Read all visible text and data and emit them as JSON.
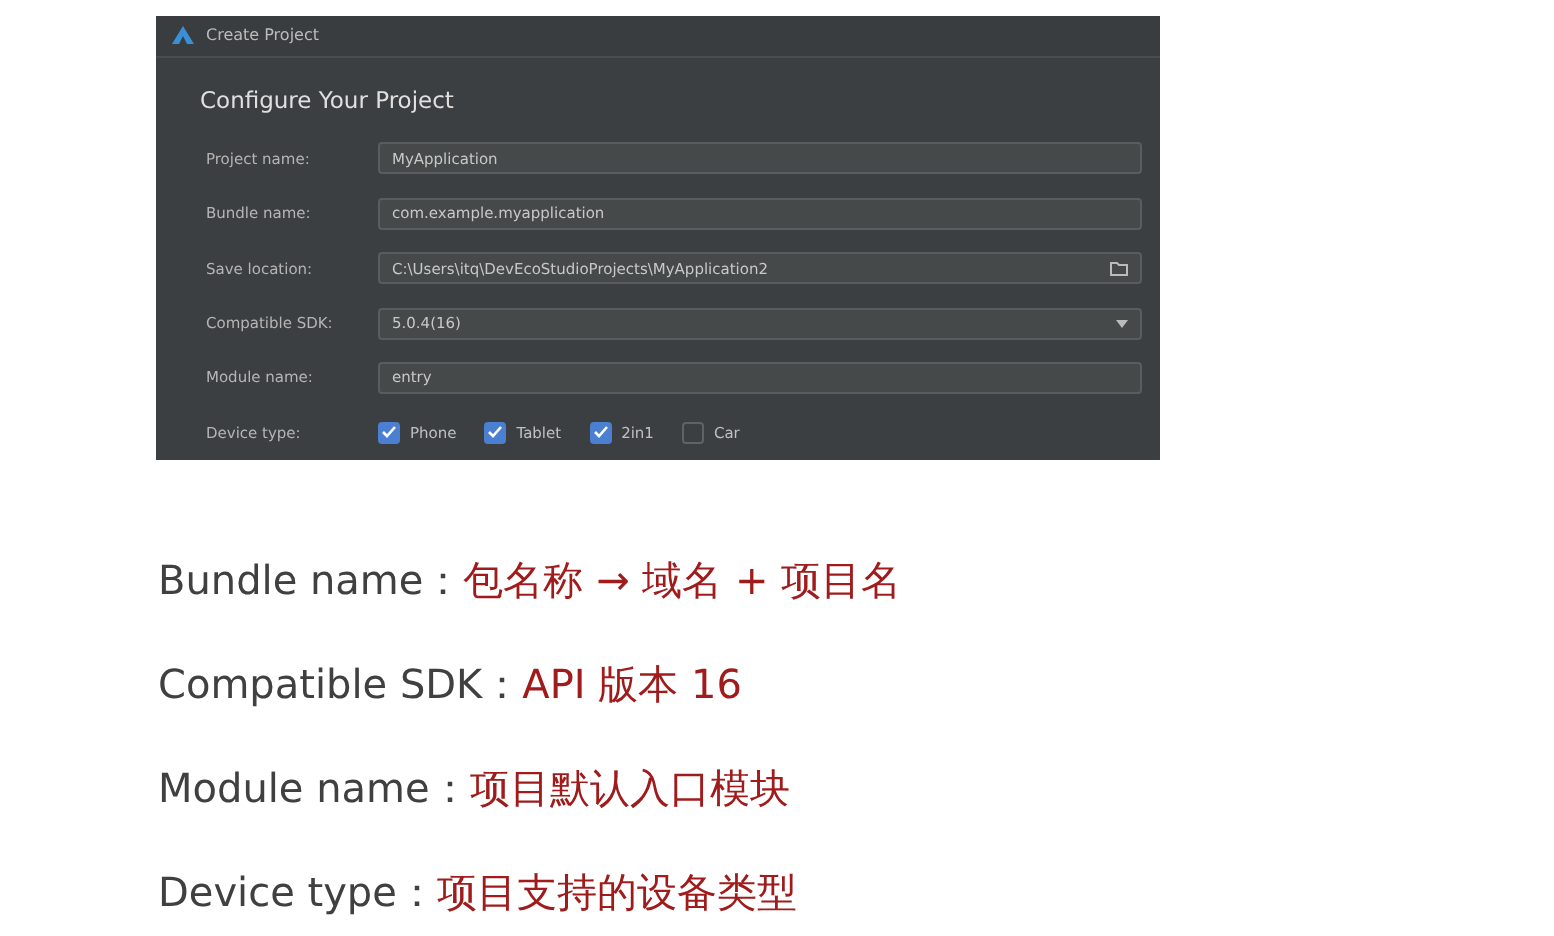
{
  "window": {
    "title": "Create Project"
  },
  "heading": "Configure Your Project",
  "fields": [
    {
      "label": "Project name:",
      "value": "MyApplication",
      "kind": "text"
    },
    {
      "label": "Bundle name:",
      "value": "com.example.myapplication",
      "kind": "text"
    },
    {
      "label": "Save location:",
      "value": "C:\\Users\\itq\\DevEcoStudioProjects\\MyApplication2",
      "kind": "folder"
    },
    {
      "label": "Compatible SDK:",
      "value": "5.0.4(16)",
      "kind": "dropdown"
    },
    {
      "label": "Module name:",
      "value": "entry",
      "kind": "text"
    }
  ],
  "device_type": {
    "label": "Device type:",
    "options": [
      {
        "label": "Phone",
        "checked": true
      },
      {
        "label": "Tablet",
        "checked": true
      },
      {
        "label": "2in1",
        "checked": true
      },
      {
        "label": "Car",
        "checked": false
      }
    ]
  },
  "notes": [
    {
      "term": "Bundle name：",
      "explanation": "包名称 → 域名 + 项目名"
    },
    {
      "term": "Compatible SDK：",
      "explanation": "API 版本 16"
    },
    {
      "term": "Module name：",
      "explanation": "项目默认入口模块"
    },
    {
      "term": "Device type：",
      "explanation": "项目支持的设备类型"
    }
  ]
}
